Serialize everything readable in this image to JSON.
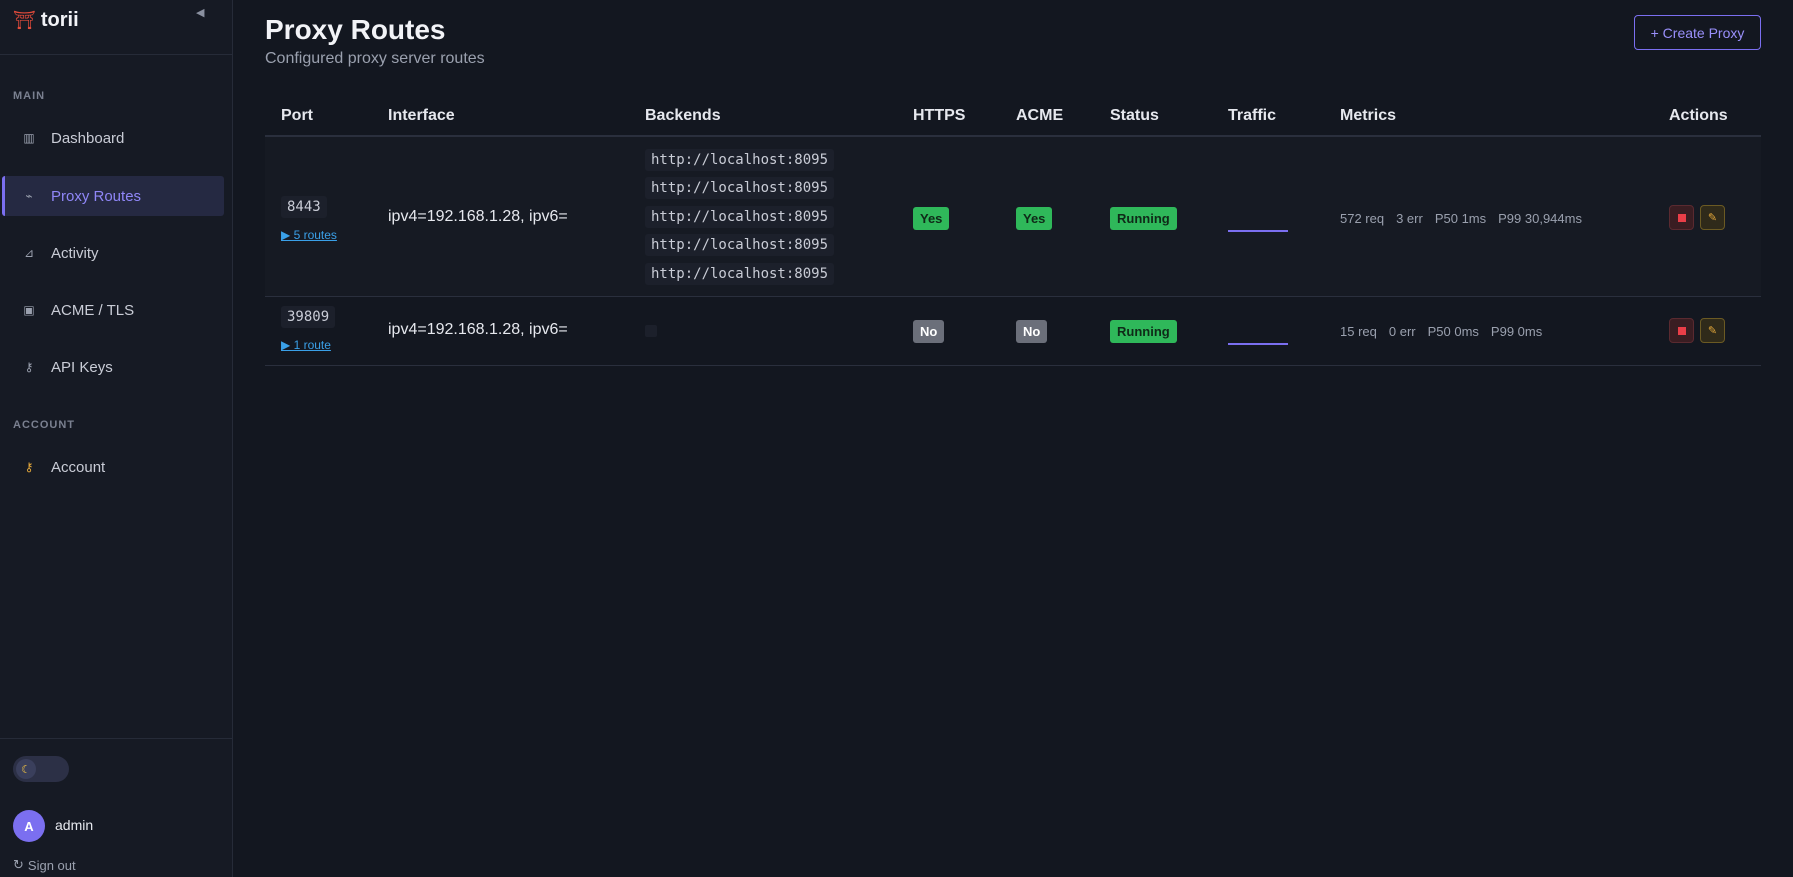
{
  "brand": {
    "logo_icon": "torii-gate-icon",
    "name": "torii"
  },
  "sidebar": {
    "sections": [
      {
        "label": "MAIN"
      },
      {
        "label": "ACCOUNT"
      }
    ],
    "items": [
      {
        "label": "Dashboard",
        "icon": "chart-icon"
      },
      {
        "label": "Proxy Routes",
        "icon": "plug-icon",
        "active": true
      },
      {
        "label": "Activity",
        "icon": "satellite-icon"
      },
      {
        "label": "ACME / TLS",
        "icon": "lock-icon"
      },
      {
        "label": "API Keys",
        "icon": "key-icon"
      },
      {
        "label": "Account",
        "icon": "key-icon"
      }
    ],
    "user": {
      "initial": "A",
      "name": "admin"
    },
    "signout_label": "Sign out"
  },
  "page": {
    "title": "Proxy Routes",
    "subtitle": "Configured proxy server routes",
    "create_button": "+ Create Proxy"
  },
  "table": {
    "headers": [
      "Port",
      "Interface",
      "Backends",
      "HTTPS",
      "ACME",
      "Status",
      "Traffic",
      "Metrics",
      "Actions"
    ],
    "rows": [
      {
        "port": "8443",
        "routes_link": "▶ 5 routes",
        "interface": "ipv4=192.168.1.28, ipv6=",
        "backends": [
          "http://localhost:8095",
          "http://localhost:8095",
          "http://localhost:8095",
          "http://localhost:8095",
          "http://localhost:8095"
        ],
        "https": "Yes",
        "acme": "Yes",
        "status": "Running",
        "metrics": {
          "req": "572 req",
          "err": "3 err",
          "p50": "P50 1ms",
          "p99": "P99 30,944ms"
        }
      },
      {
        "port": "39809",
        "routes_link": "▶ 1 route",
        "interface": "ipv4=192.168.1.28, ipv6=",
        "backends": [],
        "https": "No",
        "acme": "No",
        "status": "Running",
        "metrics": {
          "req": "15 req",
          "err": "0 err",
          "p50": "P50 0ms",
          "p99": "P99 0ms"
        }
      }
    ]
  },
  "colors": {
    "accent": "#7b6ff0",
    "success": "#2fb85a",
    "danger": "#ea3e48",
    "muted": "#6b6f7a"
  }
}
